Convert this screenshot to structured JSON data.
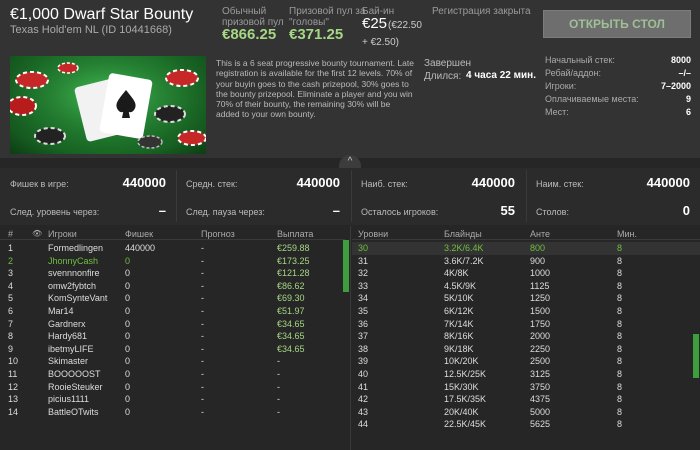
{
  "header": {
    "title": "€1,000 Dwarf Star Bounty",
    "subtitle": "Texas Hold'em NL (ID 10441668)",
    "regular_pool_label_1": "Обычный",
    "regular_pool_label_2": "призовой пул",
    "regular_pool_value": "€866.25",
    "bounty_pool_label_1": "Призовой пул за",
    "bounty_pool_label_2": "\"головы\"",
    "bounty_pool_value": "€371.25",
    "buyin_label": "Бай-ин",
    "buyin_value": "€25",
    "buyin_sub_1": "(€22.50",
    "buyin_sub_2": "+ €2.50)",
    "registration_status": "Регистрация закрыта",
    "open_table_label": "ОТКРЫТЬ СТОЛ",
    "description": "This is a 6 seat progressive bounty tournament. Late registration is available for the first 12 levels. 70% of your buyin goes to the cash prizepool, 30% goes to the bounty prizepool. Eliminate a player and you win 70% of their bounty, the remaining 30% will be added to your own bounty.",
    "status": "Завершен",
    "duration_label": "Длился:",
    "duration_value": "4 часа 22 мин.",
    "info": [
      {
        "label": "Начальный стек:",
        "value": "8000"
      },
      {
        "label": "Ребай/аддон:",
        "value": "–/–"
      },
      {
        "label": "Игроки:",
        "value": "7–2000"
      },
      {
        "label": "Оплачиваемые места:",
        "value": "9"
      },
      {
        "label": "Мест:",
        "value": "6"
      }
    ],
    "collapse_icon": "^"
  },
  "stats": {
    "chips_in_play_label": "Фишек в игре:",
    "chips_in_play_value": "440000",
    "avg_stack_label": "Средн. стек:",
    "avg_stack_value": "440000",
    "max_stack_label": "Наиб. стек:",
    "max_stack_value": "440000",
    "min_stack_label": "Наим. стек:",
    "min_stack_value": "440000",
    "next_level_label": "След. уровень через:",
    "next_level_value": "–",
    "next_break_label": "След. пауза через:",
    "next_break_value": "–",
    "players_left_label": "Осталось игроков:",
    "players_left_value": "55",
    "tables_label": "Столов:",
    "tables_value": "0"
  },
  "players_table": {
    "headers": {
      "num": "#",
      "eye": "👁",
      "player": "Игроки",
      "chips": "Фишек",
      "forecast": "Прогноз",
      "payout": "Выплата"
    },
    "rows": [
      {
        "num": "1",
        "name": "Formedlingen",
        "chips": "440000",
        "forecast": "-",
        "payout": "€259.88",
        "highlight": false
      },
      {
        "num": "2",
        "name": "JhonnyCash",
        "chips": "0",
        "forecast": "-",
        "payout": "€173.25",
        "highlight": true
      },
      {
        "num": "3",
        "name": "svennnonfire",
        "chips": "0",
        "forecast": "-",
        "payout": "€121.28",
        "highlight": false
      },
      {
        "num": "4",
        "name": "omw2fybtch",
        "chips": "0",
        "forecast": "-",
        "payout": "€86.62",
        "highlight": false
      },
      {
        "num": "5",
        "name": "KomSynteVant",
        "chips": "0",
        "forecast": "-",
        "payout": "€69.30",
        "highlight": false
      },
      {
        "num": "6",
        "name": "Mar14",
        "chips": "0",
        "forecast": "-",
        "payout": "€51.97",
        "highlight": false
      },
      {
        "num": "7",
        "name": "Gardnerx",
        "chips": "0",
        "forecast": "-",
        "payout": "€34.65",
        "highlight": false
      },
      {
        "num": "8",
        "name": "Hardy681",
        "chips": "0",
        "forecast": "-",
        "payout": "€34.65",
        "highlight": false
      },
      {
        "num": "9",
        "name": "ibetmyLIFE",
        "chips": "0",
        "forecast": "-",
        "payout": "€34.65",
        "highlight": false
      },
      {
        "num": "10",
        "name": "Skimaster",
        "chips": "0",
        "forecast": "-",
        "payout": "-",
        "highlight": false
      },
      {
        "num": "11",
        "name": "BOOOOOST",
        "chips": "0",
        "forecast": "-",
        "payout": "-",
        "highlight": false
      },
      {
        "num": "12",
        "name": "RooieSteuker",
        "chips": "0",
        "forecast": "-",
        "payout": "-",
        "highlight": false
      },
      {
        "num": "13",
        "name": "picius1111",
        "chips": "0",
        "forecast": "-",
        "payout": "-",
        "highlight": false
      },
      {
        "num": "14",
        "name": "BattleOTwits",
        "chips": "0",
        "forecast": "-",
        "payout": "-",
        "highlight": false
      }
    ]
  },
  "levels_table": {
    "headers": {
      "level": "Уровни",
      "blinds": "Блайнды",
      "ante": "Анте",
      "minutes": "Мин."
    },
    "rows": [
      {
        "level": "30",
        "blinds": "3.2K/6.4K",
        "ante": "800",
        "minutes": "8",
        "current": true
      },
      {
        "level": "31",
        "blinds": "3.6K/7.2K",
        "ante": "900",
        "minutes": "8",
        "current": false
      },
      {
        "level": "32",
        "blinds": "4K/8K",
        "ante": "1000",
        "minutes": "8",
        "current": false
      },
      {
        "level": "33",
        "blinds": "4.5K/9K",
        "ante": "1125",
        "minutes": "8",
        "current": false
      },
      {
        "level": "34",
        "blinds": "5K/10K",
        "ante": "1250",
        "minutes": "8",
        "current": false
      },
      {
        "level": "35",
        "blinds": "6K/12K",
        "ante": "1500",
        "minutes": "8",
        "current": false
      },
      {
        "level": "36",
        "blinds": "7K/14K",
        "ante": "1750",
        "minutes": "8",
        "current": false
      },
      {
        "level": "37",
        "blinds": "8K/16K",
        "ante": "2000",
        "minutes": "8",
        "current": false
      },
      {
        "level": "38",
        "blinds": "9K/18K",
        "ante": "2250",
        "minutes": "8",
        "current": false
      },
      {
        "level": "39",
        "blinds": "10K/20K",
        "ante": "2500",
        "minutes": "8",
        "current": false
      },
      {
        "level": "40",
        "blinds": "12.5K/25K",
        "ante": "3125",
        "minutes": "8",
        "current": false
      },
      {
        "level": "41",
        "blinds": "15K/30K",
        "ante": "3750",
        "minutes": "8",
        "current": false
      },
      {
        "level": "42",
        "blinds": "17.5K/35K",
        "ante": "4375",
        "minutes": "8",
        "current": false
      },
      {
        "level": "43",
        "blinds": "20K/40K",
        "ante": "5000",
        "minutes": "8",
        "current": false
      },
      {
        "level": "44",
        "blinds": "22.5K/45K",
        "ante": "5625",
        "minutes": "8",
        "current": false
      }
    ]
  },
  "colors": {
    "accent_green": "#a6d784",
    "highlight_green": "#6fbf3f",
    "scroll_green": "#3e9e3e"
  }
}
